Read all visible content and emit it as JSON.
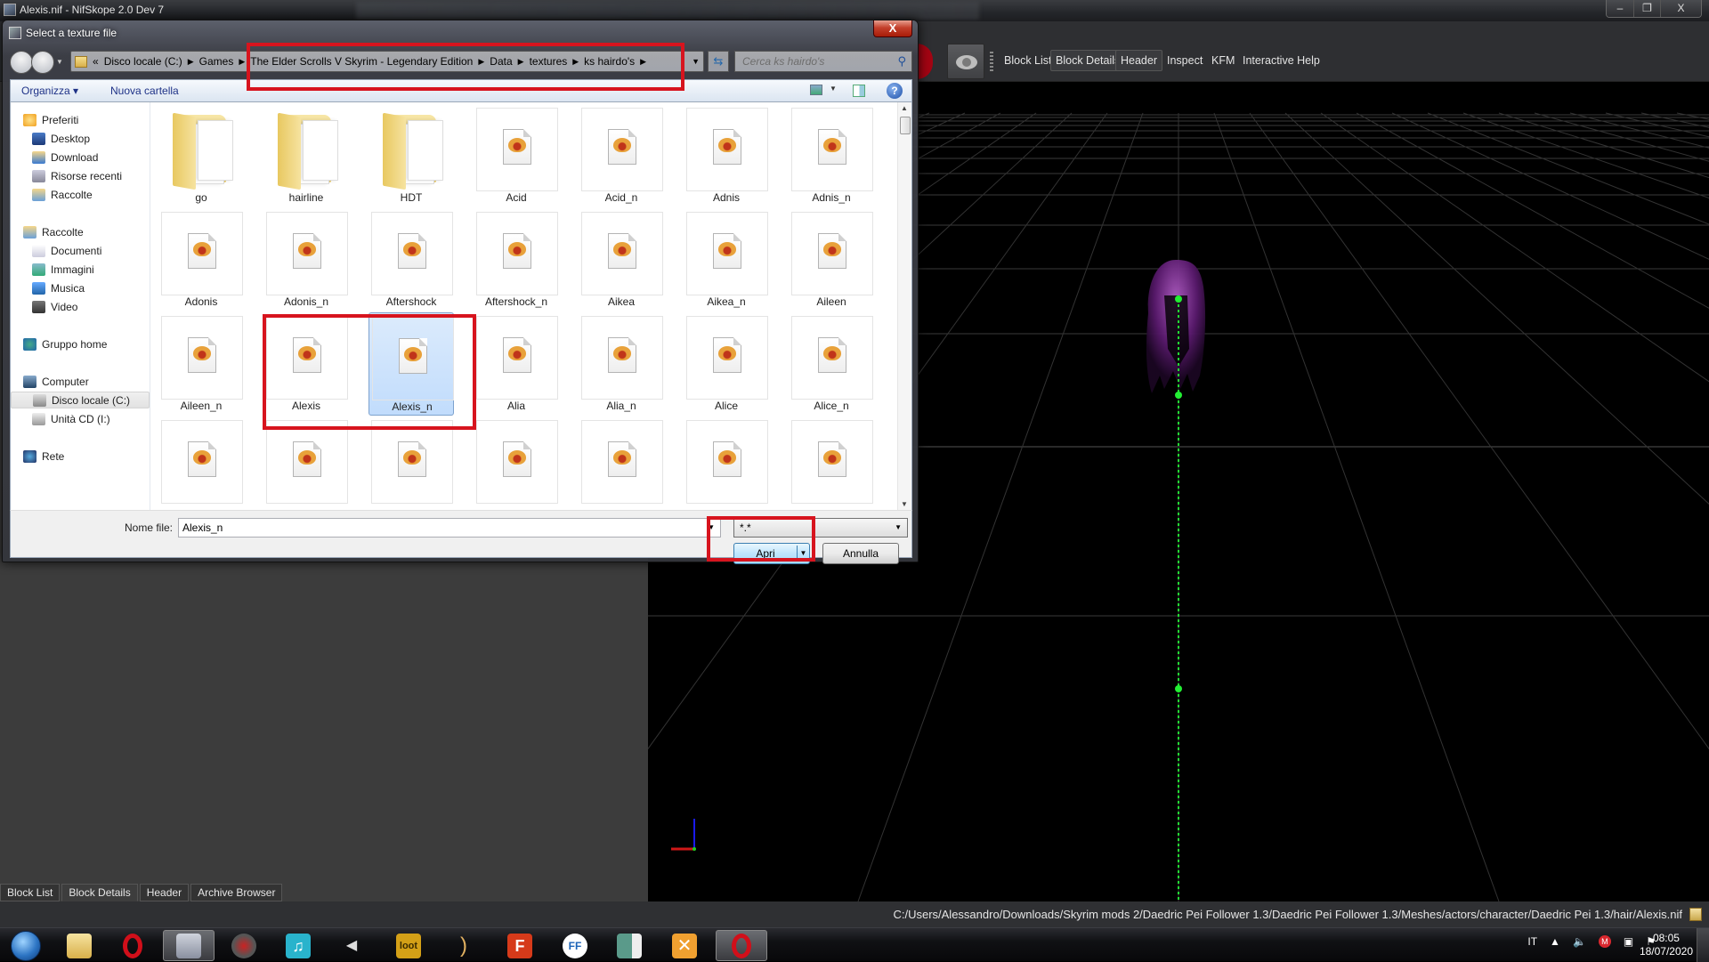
{
  "nifskope": {
    "window_title": "Alexis.nif - NifSkope 2.0 Dev 7",
    "window_controls": {
      "minimize": "–",
      "restore": "❐",
      "close": "X"
    },
    "toolbar": {
      "dock_tabs": [
        {
          "label": "Block List",
          "active": false
        },
        {
          "label": "Block Details",
          "active": true
        },
        {
          "label": "Header",
          "active": true
        },
        {
          "label": "Inspect",
          "active": false
        },
        {
          "label": "KFM",
          "active": false
        },
        {
          "label": "Interactive Help",
          "active": false
        }
      ]
    },
    "bottom_tabs": [
      {
        "label": "Block List",
        "active": false
      },
      {
        "label": "Block Details",
        "active": true
      },
      {
        "label": "Header",
        "active": false
      },
      {
        "label": "Archive Browser",
        "active": false
      }
    ],
    "status_path": "C:/Users/Alessandro/Downloads/Skyrim mods 2/Daedric Pei Follower 1.3/Daedric Pei Follower 1.3/Meshes/actors/character/Daedric Pei 1.3/hair/Alexis.nif",
    "viewport": {
      "model": "purple hair mesh",
      "model_color": "#7a2a8c",
      "bone_color": "#22dd33",
      "axis_colors": {
        "x": "#d01818",
        "y": "#22cc22",
        "z": "#1a1aee"
      }
    }
  },
  "dialog": {
    "title": "Select a texture file",
    "close_label": "X",
    "breadcrumb": [
      "Disco locale (C:)",
      "Games",
      "The Elder Scrolls V Skyrim - Legendary Edition",
      "Data",
      "textures",
      "ks hairdo's"
    ],
    "breadcrumb_prefix": "«",
    "search_placeholder": "Cerca ks hairdo's",
    "commands": {
      "organize": "Organizza ▾",
      "new_folder": "Nuova cartella"
    },
    "sidebar": [
      {
        "label": "Preferiti",
        "icon": "star-icon",
        "level": 0
      },
      {
        "label": "Desktop",
        "icon": "desktop-icon",
        "level": 1
      },
      {
        "label": "Download",
        "icon": "download-icon",
        "level": 1
      },
      {
        "label": "Risorse recenti",
        "icon": "recent-places-icon",
        "level": 1
      },
      {
        "label": "Raccolte",
        "icon": "libraries-icon",
        "level": 1
      },
      {
        "label": "Raccolte",
        "icon": "libraries-icon",
        "level": 0
      },
      {
        "label": "Documenti",
        "icon": "documents-icon",
        "level": 1
      },
      {
        "label": "Immagini",
        "icon": "pictures-icon",
        "level": 1
      },
      {
        "label": "Musica",
        "icon": "music-icon",
        "level": 1
      },
      {
        "label": "Video",
        "icon": "video-icon",
        "level": 1
      },
      {
        "label": "Gruppo home",
        "icon": "homegroup-icon",
        "level": 0
      },
      {
        "label": "Computer",
        "icon": "computer-icon",
        "level": 0
      },
      {
        "label": "Disco locale (C:)",
        "icon": "drive-icon",
        "level": 1,
        "selected": true
      },
      {
        "label": "Unità CD (I:)",
        "icon": "cd-drive-icon",
        "level": 1
      },
      {
        "label": "Rete",
        "icon": "network-icon",
        "level": 0
      }
    ],
    "files": [
      {
        "name": "go",
        "type": "folder"
      },
      {
        "name": "hairline",
        "type": "folder"
      },
      {
        "name": "HDT",
        "type": "folder"
      },
      {
        "name": "Acid",
        "type": "file"
      },
      {
        "name": "Acid_n",
        "type": "file"
      },
      {
        "name": "Adnis",
        "type": "file"
      },
      {
        "name": "Adnis_n",
        "type": "file"
      },
      {
        "name": "Adonis",
        "type": "file"
      },
      {
        "name": "Adonis_n",
        "type": "file"
      },
      {
        "name": "Aftershock",
        "type": "file"
      },
      {
        "name": "Aftershock_n",
        "type": "file"
      },
      {
        "name": "Aikea",
        "type": "file"
      },
      {
        "name": "Aikea_n",
        "type": "file"
      },
      {
        "name": "Aileen",
        "type": "file"
      },
      {
        "name": "Aileen_n",
        "type": "file"
      },
      {
        "name": "Alexis",
        "type": "file"
      },
      {
        "name": "Alexis_n",
        "type": "file",
        "selected": true
      },
      {
        "name": "Alia",
        "type": "file"
      },
      {
        "name": "Alia_n",
        "type": "file"
      },
      {
        "name": "Alice",
        "type": "file"
      },
      {
        "name": "Alice_n",
        "type": "file"
      },
      {
        "name": "",
        "type": "file"
      },
      {
        "name": "",
        "type": "file"
      },
      {
        "name": "",
        "type": "file"
      },
      {
        "name": "",
        "type": "file"
      },
      {
        "name": "",
        "type": "file"
      },
      {
        "name": "",
        "type": "file"
      },
      {
        "name": "",
        "type": "file"
      }
    ],
    "filename_label": "Nome file:",
    "filename_value": "Alexis_n",
    "filter_value": "*.*",
    "open_label": "Apri",
    "cancel_label": "Annulla",
    "highlight_color": "#d7141e"
  },
  "taskbar": {
    "items": [
      "start-orb",
      "explorer",
      "opera",
      "nifskope",
      "skyrim-launcher",
      "music-player",
      "volume-app",
      "loot",
      "bodyslide",
      "flash-app",
      "ffdec",
      "app-window",
      "xnview",
      "opera-active"
    ],
    "tray": {
      "language": "IT",
      "time": "08:05",
      "date": "18/07/2020"
    }
  }
}
